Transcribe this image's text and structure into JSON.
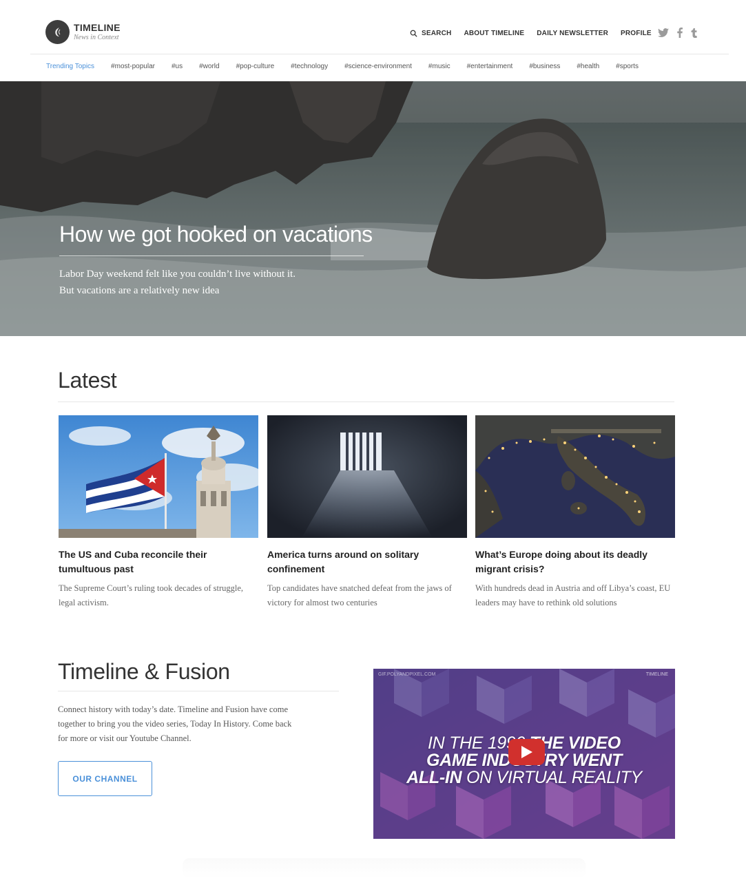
{
  "brand": {
    "title": "TIMELINE",
    "tagline": "News in Context"
  },
  "nav": {
    "search": "SEARCH",
    "about": "ABOUT TIMELINE",
    "newsletter": "DAILY NEWSLETTER",
    "profile": "PROFILE"
  },
  "social": [
    "twitter-icon",
    "facebook-icon",
    "tumblr-icon"
  ],
  "topics": {
    "label": "Trending Topics",
    "items": [
      "#most-popular",
      "#us",
      "#world",
      "#pop-culture",
      "#technology",
      "#science-environment",
      "#music",
      "#entertainment",
      "#business",
      "#health",
      "#sports"
    ]
  },
  "hero": {
    "title": "How we got hooked on vacations",
    "description": "Labor Day weekend felt like you couldn’t live without it. But vacations are a relatively new idea"
  },
  "latest": {
    "heading": "Latest",
    "cards": [
      {
        "title": "The US and Cuba reconcile their tumultuous past",
        "description": "The Supreme Court’s ruling took decades of struggle, legal activism."
      },
      {
        "title": "America turns around on solitary confinement",
        "description": "Top candidates have snatched defeat from the jaws of victory for almost two centuries"
      },
      {
        "title": "What’s Europe doing about its deadly migrant crisis?",
        "description": "With hundreds dead in Austria and off Libya’s coast, EU leaders may have to rethink old solutions"
      }
    ]
  },
  "fusion": {
    "heading": "Timeline & Fusion",
    "description": "Connect history with today’s date. Timeline and Fusion have come together to bring you the video series, Today In History. Come back for more or visit our Youtube Channel.",
    "button": "OUR CHANNEL",
    "video": {
      "source": "GIF.POLYANDPIXEL.COM",
      "brand": "TIMELINE",
      "line1_light": "IN THE 1990",
      "line1_bold": "THE VIDEO",
      "line2_bold": "GAME INDUSTRY WENT",
      "line3_bold": "ALL-IN",
      "line3_light": "ON VIRTUAL REALITY"
    }
  },
  "colors": {
    "accent": "#4a90d9",
    "play": "#d1302d"
  }
}
